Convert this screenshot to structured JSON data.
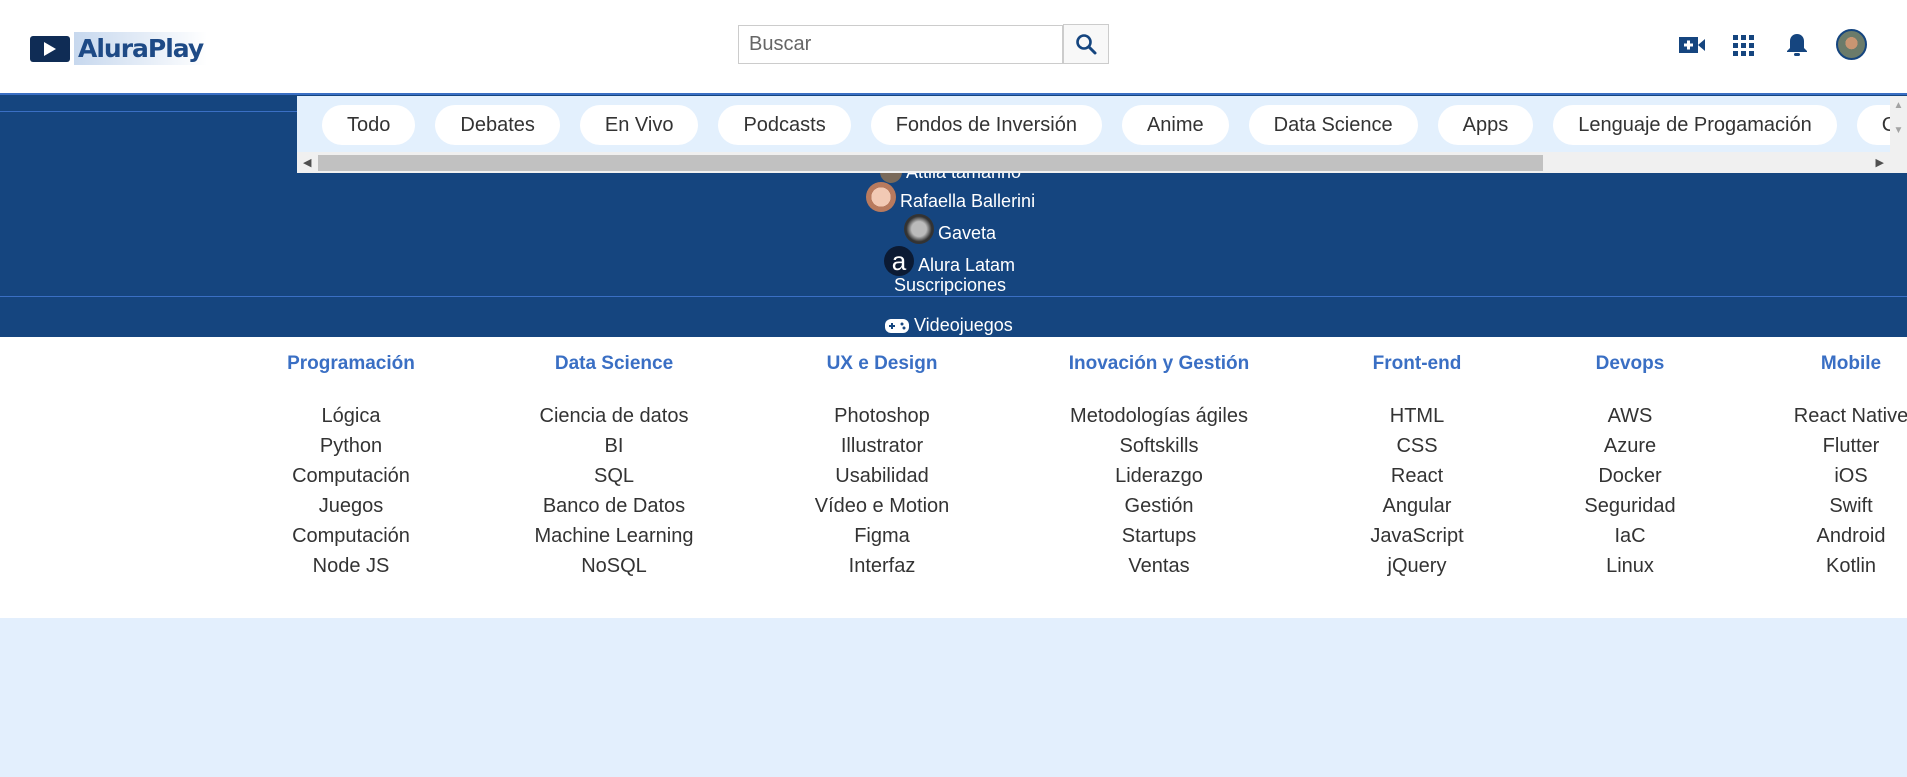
{
  "header": {
    "logo": "AluraPlay",
    "search_placeholder": "Buscar",
    "icons": [
      "video-plus-icon",
      "apps-grid-icon",
      "bell-icon",
      "user-avatar"
    ]
  },
  "chips": [
    "Todo",
    "Debates",
    "En Vivo",
    "Podcasts",
    "Fondos de Inversión",
    "Anime",
    "Data Science",
    "Apps",
    "Lenguaje de Progamación",
    "Cie"
  ],
  "sidebar": {
    "subscriptions": [
      "Attila tamanho",
      "Rafaella Ballerini",
      "Gaveta",
      "Alura Latam"
    ],
    "subscriptions_title": "Suscripciones",
    "videogames": "Videojuegos"
  },
  "footer": {
    "columns": [
      {
        "title": "Programación",
        "items": [
          "Lógica",
          "Python",
          "Computación",
          "Juegos",
          "Computación",
          "Node JS"
        ]
      },
      {
        "title": "Data Science",
        "items": [
          "Ciencia de datos",
          "BI",
          "SQL",
          "Banco de Datos",
          "Machine Learning",
          "NoSQL"
        ]
      },
      {
        "title": "UX e Design",
        "items": [
          "Photoshop",
          "Illustrator",
          "Usabilidad",
          "Vídeo e Motion",
          "Figma",
          "Interfaz"
        ]
      },
      {
        "title": "Inovación y Gestión",
        "items": [
          "Metodologías ágiles",
          "Softskills",
          "Liderazgo",
          "Gestión",
          "Startups",
          "Ventas"
        ]
      },
      {
        "title": "Front-end",
        "items": [
          "HTML",
          "CSS",
          "React",
          "Angular",
          "JavaScript",
          "jQuery"
        ]
      },
      {
        "title": "Devops",
        "items": [
          "AWS",
          "Azure",
          "Docker",
          "Seguridad",
          "IaC",
          "Linux"
        ]
      },
      {
        "title": "Mobile",
        "items": [
          "React Native",
          "Flutter",
          "iOS",
          "Swift",
          "Android",
          "Kotlin"
        ]
      }
    ]
  },
  "colors": {
    "primary": "#15457f",
    "accent": "#3a6fc4",
    "chip_bg": "#e3f0fd"
  }
}
